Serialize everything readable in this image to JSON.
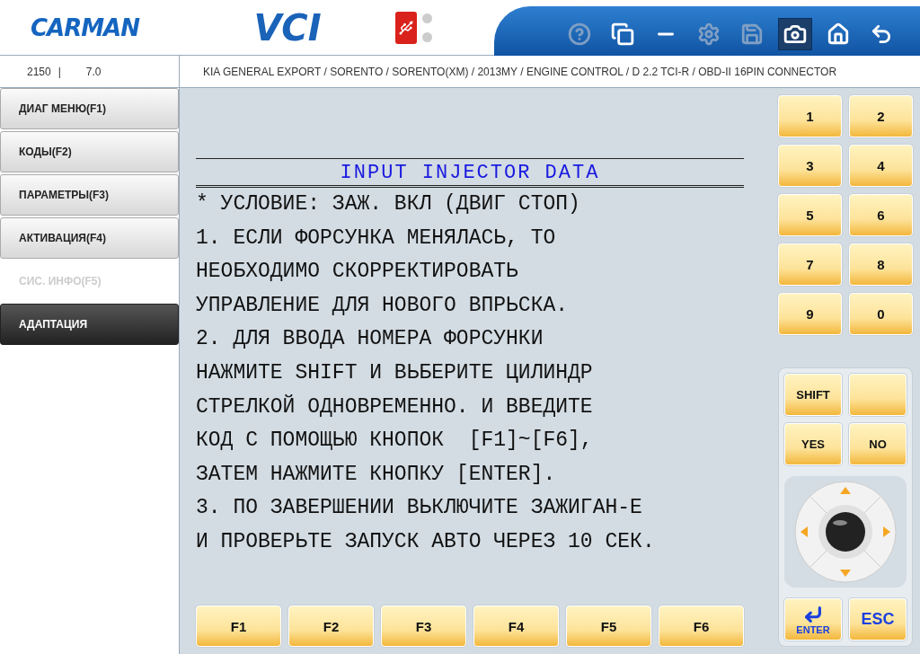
{
  "header": {
    "logo": "CARMAN",
    "product": "VCI"
  },
  "toolbar": [
    {
      "kind": "help",
      "disabled": true,
      "selected": false
    },
    {
      "kind": "windows",
      "disabled": false,
      "selected": false
    },
    {
      "kind": "minimize",
      "disabled": false,
      "selected": false
    },
    {
      "kind": "settings",
      "disabled": true,
      "selected": false
    },
    {
      "kind": "save",
      "disabled": true,
      "selected": false
    },
    {
      "kind": "camera",
      "disabled": false,
      "selected": true
    },
    {
      "kind": "home",
      "disabled": false,
      "selected": false
    },
    {
      "kind": "back",
      "disabled": false,
      "selected": false
    }
  ],
  "info": {
    "code": "2150",
    "separator": "|",
    "version": "7.0",
    "path": "KIA GENERAL EXPORT / SORENTO / SORENTO(XM) / 2013MY / ENGINE CONTROL / D 2.2 TCI-R / OBD-II 16PIN CONNECTOR"
  },
  "sidebar": {
    "items": [
      {
        "label": "ДИАГ МЕНЮ(F1)",
        "disabled": false,
        "selected": false
      },
      {
        "label": "КОДЫ(F2)",
        "disabled": false,
        "selected": false
      },
      {
        "label": "ПАРАМЕТРЫ(F3)",
        "disabled": false,
        "selected": false
      },
      {
        "label": "АКТИВАЦИЯ(F4)",
        "disabled": false,
        "selected": false
      },
      {
        "label": "СИС. ИНФО(F5)",
        "disabled": true,
        "selected": false
      },
      {
        "label": "АДАПТАЦИЯ",
        "disabled": false,
        "selected": true
      }
    ]
  },
  "content": {
    "title": "INPUT INJECTOR DATA",
    "lines": [
      "* УСЛОВИЕ: ЗАЖ. ВКЛ (ДВИГ СТОП)",
      "1. ЕСЛИ ФОРСУНКА МЕНЯЛАСЬ, ТО",
      "НЕОБХОДИМО СКОРРЕКТИРОВАТЬ",
      "УПРАВЛЕНИЕ ДЛЯ НОВОГО ВПРЬСКА.",
      "2. ДЛЯ ВВОДА НОМЕРА ФОРСУНКИ",
      "НАЖМИТЕ SHIFT И ВЬБЕРИТЕ ЦИЛИНДР",
      "СТРЕЛКОЙ ОДНОВРЕМЕННО. И ВВЕДИТЕ",
      "КОД С ПОМОЩЬЮ КНОПОК  [F1]~[F6],",
      "ЗАТЕМ НАЖМИТЕ КНОПКУ [ENTER].",
      "3. ПО ЗАВЕРШЕНИИ ВЬКЛЮЧИТЕ ЗАЖИГАН-Е",
      "И ПРОВЕРЬТЕ ЗАПУСК АВТО ЧЕРЕЗ 10 СЕК."
    ]
  },
  "function_keys": [
    "F1",
    "F2",
    "F3",
    "F4",
    "F5",
    "F6"
  ],
  "numpad": [
    "1",
    "2",
    "3",
    "4",
    "5",
    "6",
    "7",
    "8",
    "9",
    "0"
  ],
  "control_keys": [
    {
      "kind": "label",
      "label": "SHIFT"
    },
    {
      "kind": "blank"
    },
    {
      "kind": "label",
      "label": "YES"
    },
    {
      "kind": "label",
      "label": "NO"
    }
  ],
  "enter_key": "ENTER",
  "esc_key": "ESC"
}
